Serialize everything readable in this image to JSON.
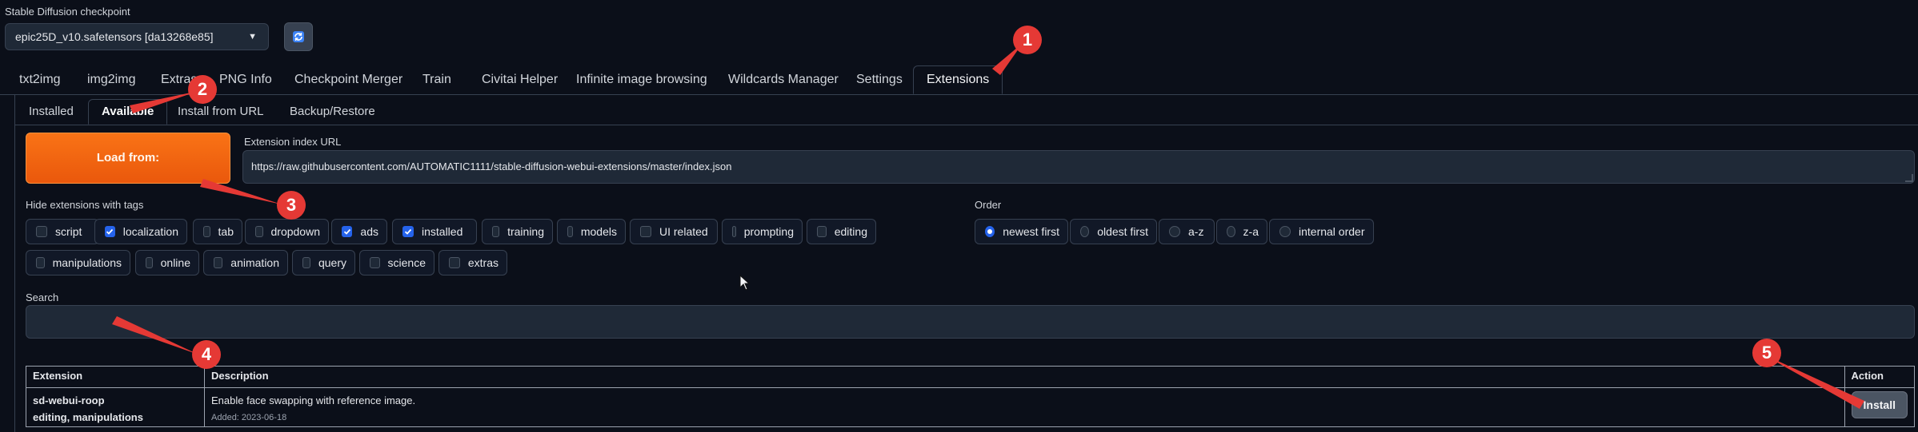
{
  "checkpoint": {
    "label": "Stable Diffusion checkpoint",
    "value": "epic25D_v10.safetensors [da13268e85]",
    "refresh_icon": "refresh-icon"
  },
  "main_tabs": [
    "txt2img",
    "img2img",
    "Extras",
    "PNG Info",
    "Checkpoint Merger",
    "Train",
    "Civitai Helper",
    "Infinite image browsing",
    "Wildcards Manager",
    "Settings",
    "Extensions"
  ],
  "sub_tabs": [
    "Installed",
    "Available",
    "Install from URL",
    "Backup/Restore"
  ],
  "load_button": "Load from:",
  "url": {
    "label": "Extension index URL",
    "value": "https://raw.githubusercontent.com/AUTOMATIC1111/stable-diffusion-webui-extensions/master/index.json"
  },
  "hide_tags": {
    "label": "Hide extensions with tags",
    "items": [
      {
        "label": "script",
        "checked": false
      },
      {
        "label": "localization",
        "checked": true
      },
      {
        "label": "tab",
        "checked": false
      },
      {
        "label": "dropdown",
        "checked": false
      },
      {
        "label": "ads",
        "checked": true
      },
      {
        "label": "installed",
        "checked": true
      },
      {
        "label": "training",
        "checked": false
      },
      {
        "label": "models",
        "checked": false
      },
      {
        "label": "UI related",
        "checked": false
      },
      {
        "label": "prompting",
        "checked": false
      },
      {
        "label": "editing",
        "checked": false
      },
      {
        "label": "manipulations",
        "checked": false
      },
      {
        "label": "online",
        "checked": false
      },
      {
        "label": "animation",
        "checked": false
      },
      {
        "label": "query",
        "checked": false
      },
      {
        "label": "science",
        "checked": false
      },
      {
        "label": "extras",
        "checked": false
      }
    ]
  },
  "order": {
    "label": "Order",
    "items": [
      {
        "label": "newest first",
        "selected": true
      },
      {
        "label": "oldest first",
        "selected": false
      },
      {
        "label": "a-z",
        "selected": false
      },
      {
        "label": "z-a",
        "selected": false
      },
      {
        "label": "internal order",
        "selected": false
      }
    ]
  },
  "search": {
    "label": "Search",
    "value": ""
  },
  "table": {
    "headers": [
      "Extension",
      "Description",
      "Action"
    ],
    "rows": [
      {
        "name": "sd-webui-roop",
        "tags": "editing, manipulations",
        "description": "Enable face swapping with reference image.",
        "added": "Added: 2023-06-18",
        "action": "Install"
      }
    ]
  },
  "markers": [
    "1",
    "2",
    "3",
    "4",
    "5"
  ],
  "colors": {
    "accent": "#f97316",
    "marker": "#e53935",
    "checkbox": "#2563eb",
    "background": "#0b0f19"
  }
}
